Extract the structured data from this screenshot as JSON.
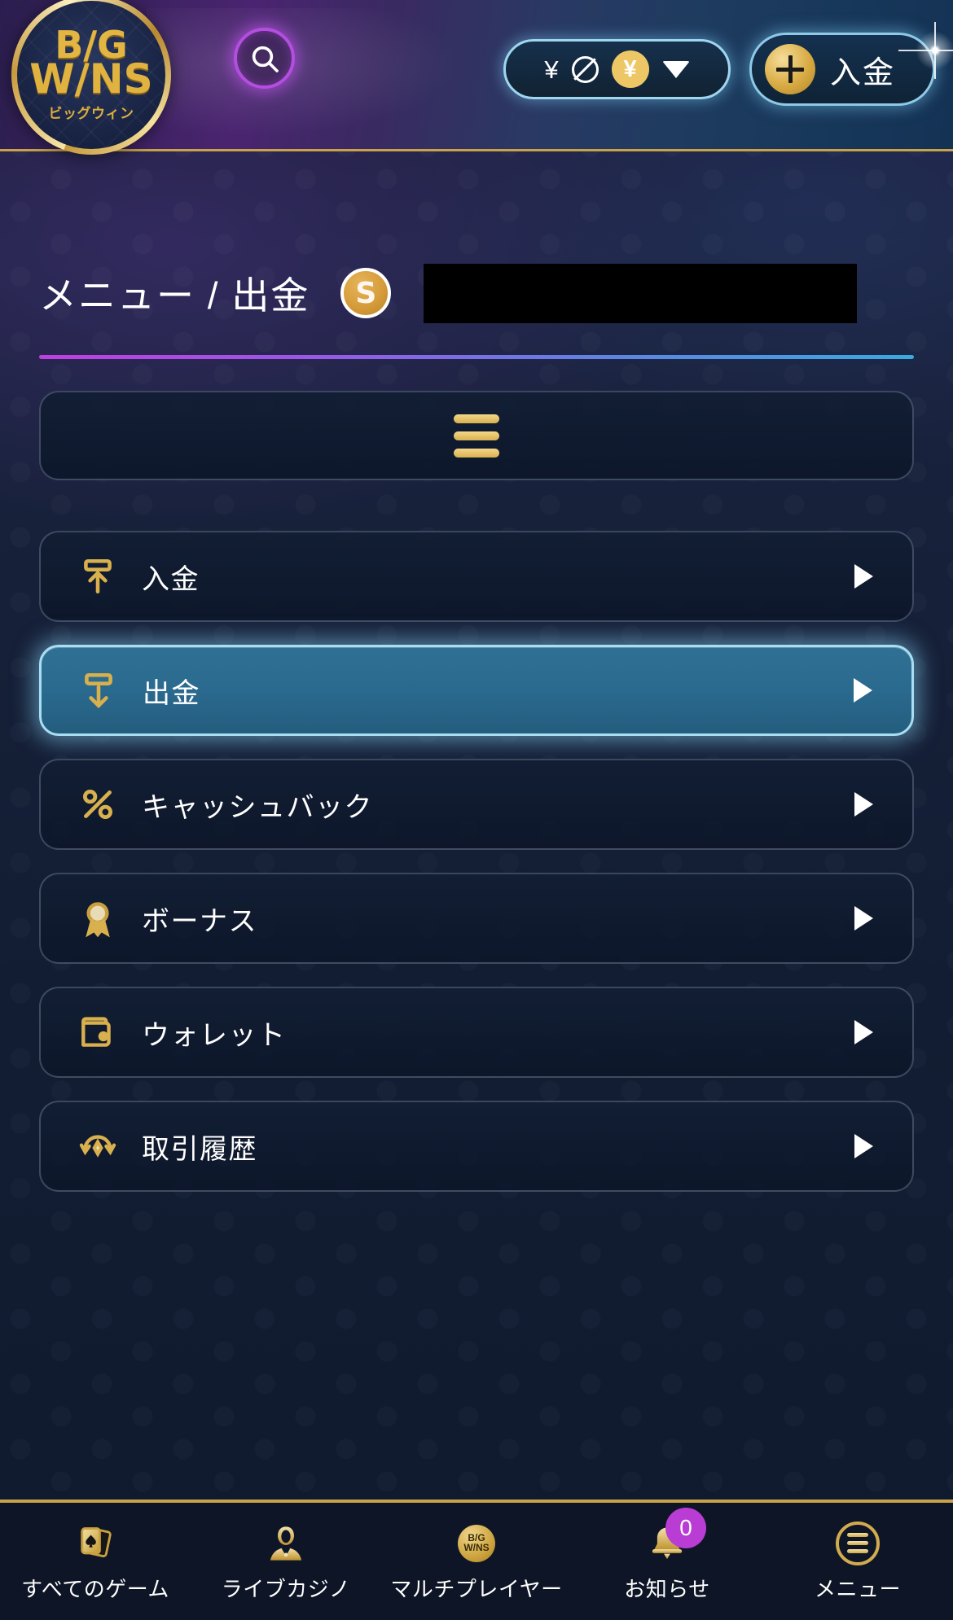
{
  "header": {
    "logo": {
      "line1": "B/G",
      "line2": "W/NS",
      "subtitle": "ビッグウィン"
    },
    "search_icon": "search-icon",
    "balance_chip": {
      "currency_glyph": "¥",
      "null_icon": "no-entry-icon",
      "coin_glyph": "¥",
      "caret_icon": "chevron-down-icon"
    },
    "deposit_button": {
      "label": "入金",
      "icon": "plus-circle-icon"
    }
  },
  "title_area": {
    "title": "メニュー / 出金",
    "avatar_letter": "S",
    "username_redacted": ""
  },
  "hamburger": {
    "icon": "hamburger-icon"
  },
  "menu": {
    "items": [
      {
        "label": "入金",
        "icon": "deposit-arrow-up-icon",
        "selected": false
      },
      {
        "label": "出金",
        "icon": "withdraw-arrow-down-icon",
        "selected": true
      },
      {
        "label": "キャッシュバック",
        "icon": "percent-icon",
        "selected": false
      },
      {
        "label": "ボーナス",
        "icon": "medal-ribbon-icon",
        "selected": false
      },
      {
        "label": "ウォレット",
        "icon": "wallet-icon",
        "selected": false
      },
      {
        "label": "取引履歴",
        "icon": "transaction-history-icon",
        "selected": false
      }
    ],
    "caret_icon": "play-caret-icon"
  },
  "bottom_nav": {
    "items": [
      {
        "label": "すべてのゲーム",
        "icon": "playing-cards-icon"
      },
      {
        "label": "ライブカジノ",
        "icon": "live-dealer-icon"
      },
      {
        "label": "マルチプレイヤー",
        "icon": "bigwins-coin-icon"
      },
      {
        "label": "お知らせ",
        "icon": "bell-icon",
        "badge": "0"
      },
      {
        "label": "メニュー",
        "icon": "menu-circle-icon"
      }
    ]
  },
  "colors": {
    "gold": "#d9b04e",
    "accent_purple": "#b93dd4",
    "accent_cyan": "#a8ddf2",
    "selected_fill": "#2a6a8e",
    "panel_bg": "#101c34"
  }
}
